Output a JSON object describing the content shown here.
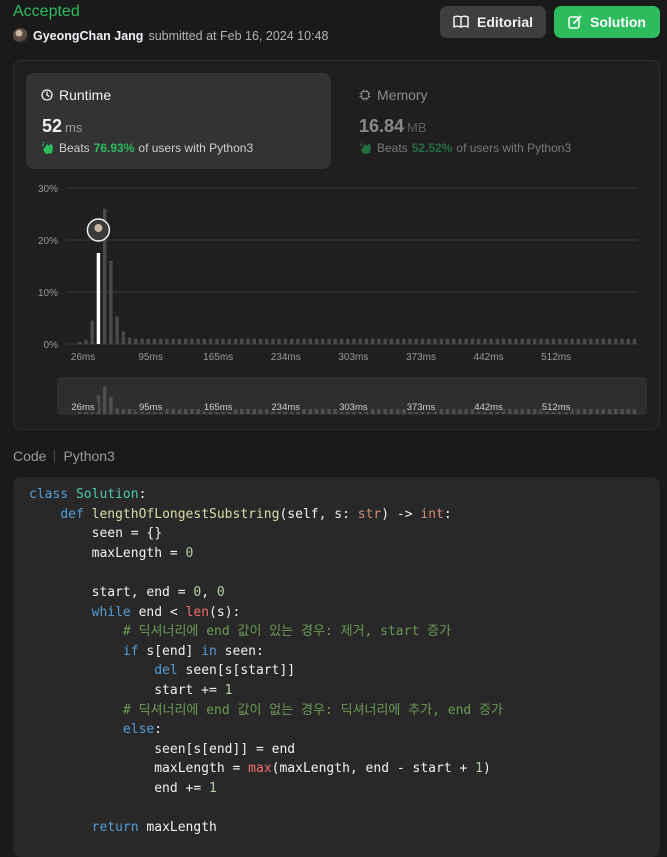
{
  "header": {
    "status": "Accepted",
    "user": "GyeongChan Jang",
    "submitted_text": "submitted at Feb 16, 2024 10:48",
    "editorial_label": "Editorial",
    "solution_label": "Solution"
  },
  "runtime": {
    "title": "Runtime",
    "value": "52",
    "unit": "ms",
    "beats_label": "Beats",
    "beats_pct": "76.93%",
    "beats_suffix": "of users with Python3"
  },
  "memory": {
    "title": "Memory",
    "value": "16.84",
    "unit": "MB",
    "beats_label": "Beats",
    "beats_pct": "52.52%",
    "beats_suffix": "of users with Python3"
  },
  "colors": {
    "accent_green": "#2cbb5d",
    "bar": "#4a4a4a",
    "bar_highlight": "#ffffff",
    "background": "#1a1a1a"
  },
  "chart_data": {
    "type": "bar",
    "y_ticks": [
      "30%",
      "20%",
      "10%",
      "0%"
    ],
    "ylim": [
      0,
      30
    ],
    "x_ticks": [
      "26ms",
      "95ms",
      "165ms",
      "234ms",
      "303ms",
      "373ms",
      "442ms",
      "512ms"
    ],
    "grid": true,
    "values": [
      0.4,
      0.8,
      4.5,
      17.5,
      26,
      16,
      5.3,
      2.4,
      1.2,
      1,
      1,
      1,
      1,
      1,
      1,
      1,
      1,
      1,
      1,
      1,
      1,
      1,
      1,
      1,
      1,
      1,
      1,
      1,
      1,
      1,
      1,
      1,
      1,
      1,
      1,
      1,
      1,
      1,
      1,
      1,
      1,
      1,
      1,
      1,
      1,
      1,
      1,
      1,
      1,
      1,
      1,
      1,
      1,
      1,
      1,
      1,
      1,
      1,
      1,
      1,
      1,
      1,
      1,
      1,
      1,
      1,
      1,
      1,
      1,
      1,
      1,
      1,
      1,
      1,
      1,
      1,
      1,
      1,
      1,
      1,
      1,
      1,
      1,
      1,
      1,
      1,
      1,
      1,
      1,
      1
    ],
    "highlight_index": 3,
    "highlight_label": "52 ms"
  },
  "code_tab": {
    "label": "Code",
    "language": "Python3"
  }
}
